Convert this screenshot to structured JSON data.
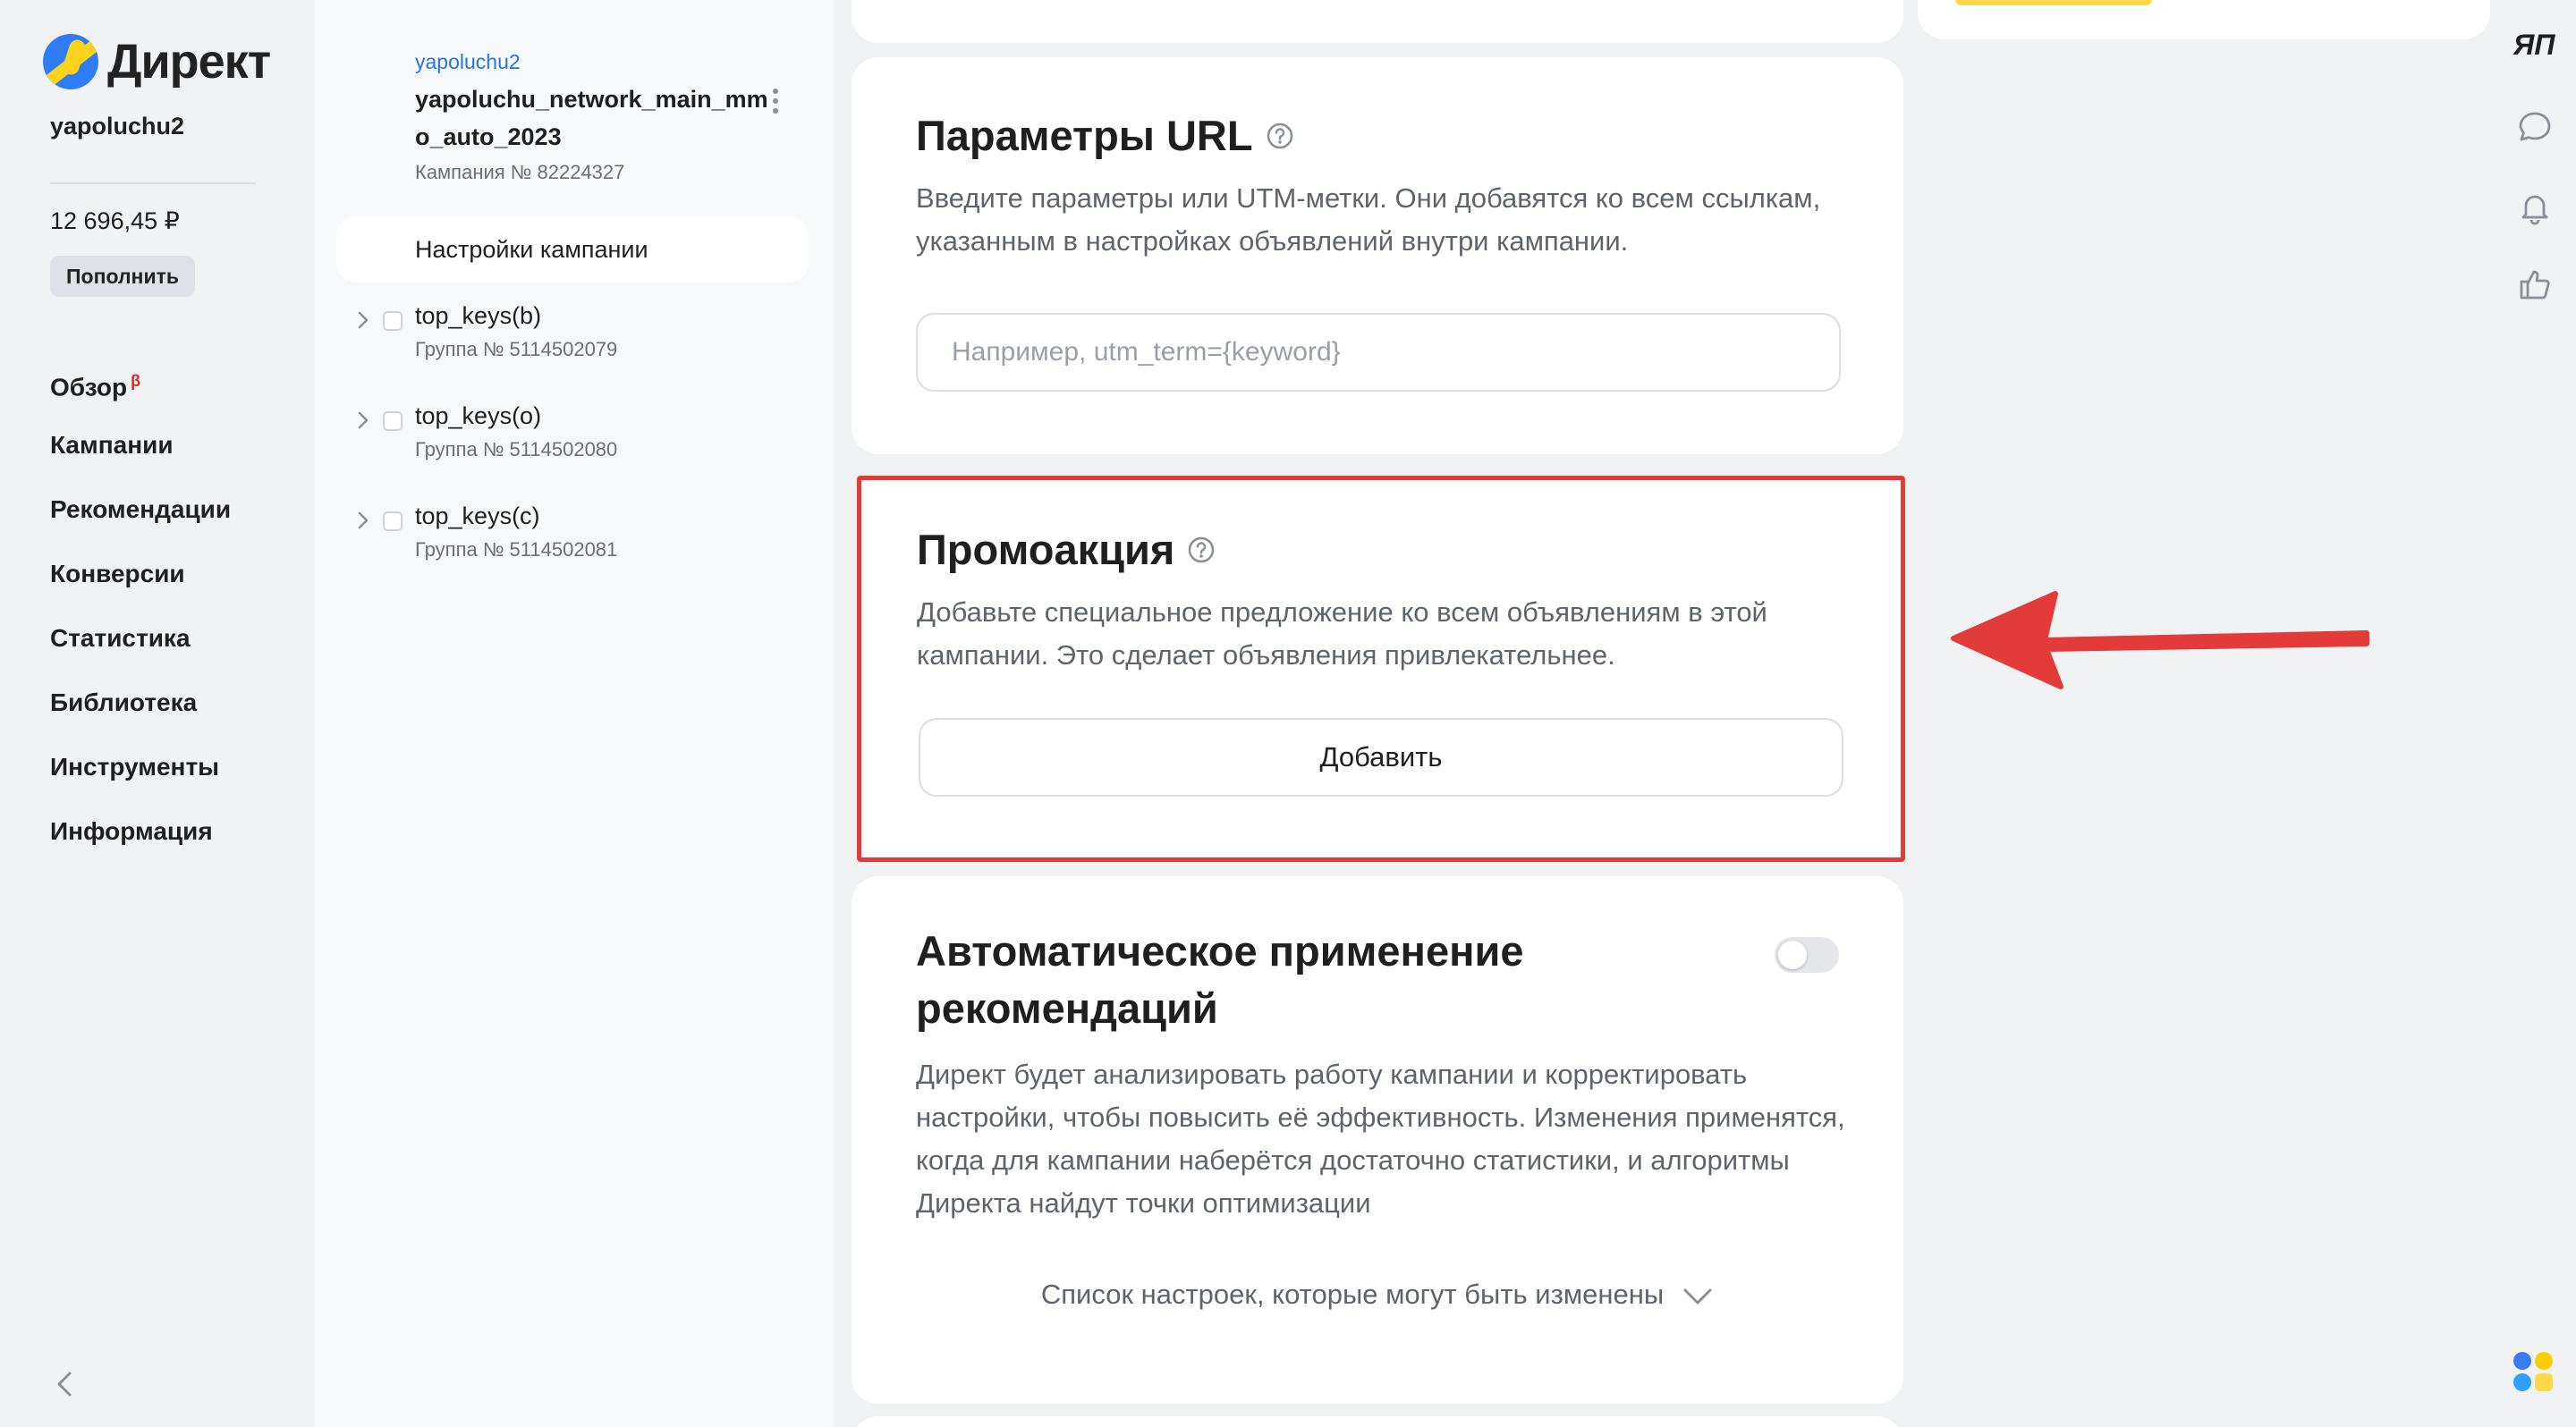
{
  "nav": {
    "logo_text": "Директ",
    "login": "yapoluchu2",
    "balance": "12 696,45 ₽",
    "topup_label": "Пополнить",
    "items": [
      {
        "label": "Обзор",
        "badge": "β"
      },
      {
        "label": "Кампании"
      },
      {
        "label": "Рекомендации"
      },
      {
        "label": "Конверсии"
      },
      {
        "label": "Статистика"
      },
      {
        "label": "Библиотека"
      },
      {
        "label": "Инструменты"
      },
      {
        "label": "Информация"
      }
    ]
  },
  "campaign": {
    "login": "yapoluchu2",
    "name": "yapoluchu_network_main_mmo_auto_2023",
    "number": "Кампания № 82224327",
    "settings_label": "Настройки кампании",
    "groups": [
      {
        "name": "top_keys(b)",
        "number": "Группа № 5114502079"
      },
      {
        "name": "top_keys(o)",
        "number": "Группа № 5114502080"
      },
      {
        "name": "top_keys(c)",
        "number": "Группа № 5114502081"
      }
    ]
  },
  "url_params": {
    "title": "Параметры URL",
    "description": "Введите параметры или UTM-метки. Они добавятся ко всем ссылкам, указанным в настройках объявлений внутри кампании.",
    "placeholder": "Например, utm_term={keyword}",
    "value": ""
  },
  "promo": {
    "title": "Промоакция",
    "description": "Добавьте специальное предложение ко всем объявлениям в этой кампании. Это сделает объявления привлекательнее.",
    "add_label": "Добавить"
  },
  "auto_reco": {
    "title": "Автоматическое применение рекомендаций",
    "toggle_on": false,
    "description": "Директ будет анализировать работу кампании и корректировать настройки, чтобы повысить её эффективность. Изменения применятся, когда для кампании наберётся достаточно статистики, и алгоритмы Директа найдут точки оптимизации",
    "list_link": "Список настроек, которые могут быть изменены"
  },
  "rail": {
    "ya_label": "ЯП"
  },
  "colors": {
    "accent_link": "#2574e0",
    "highlight_border": "#e33a3a",
    "arrow": "#e33a3a"
  }
}
